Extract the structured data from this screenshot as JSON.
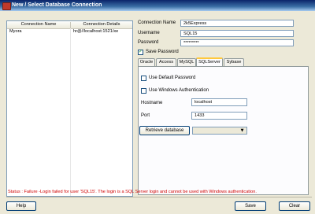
{
  "window": {
    "title": "New / Select Database Connection"
  },
  "connections": {
    "headers": [
      "Connection Name",
      "Connection Details"
    ],
    "rows": [
      {
        "name": "Myora",
        "details": "hr@//localhost:1521/xe"
      }
    ]
  },
  "form": {
    "connection_name_label": "Connection Name",
    "connection_name_value": "2k5Express",
    "username_label": "Username",
    "username_value": "SQL15",
    "password_label": "Password",
    "password_value": "*********",
    "save_password_label": "Save Password",
    "save_password_checked": true
  },
  "tabs": [
    "Oracle",
    "Access",
    "MySQL",
    "SQLServer",
    "Sybase"
  ],
  "active_tab": "SQLServer",
  "sqlserver": {
    "use_default_password_label": "Use Default Password",
    "use_windows_auth_label": "Use Windows Authentication",
    "hostname_label": "Hostname",
    "hostname_value": "localhost",
    "port_label": "Port",
    "port_value": "1433",
    "retrieve_button": "Retrieve database",
    "database_select_value": ""
  },
  "status": "Status : Failure -Login failed for user 'SQL15'. The login is a SQL Server login and cannot be used with Windows authentication.",
  "buttons": {
    "help": "Help",
    "save": "Save",
    "clear": "Clear"
  }
}
